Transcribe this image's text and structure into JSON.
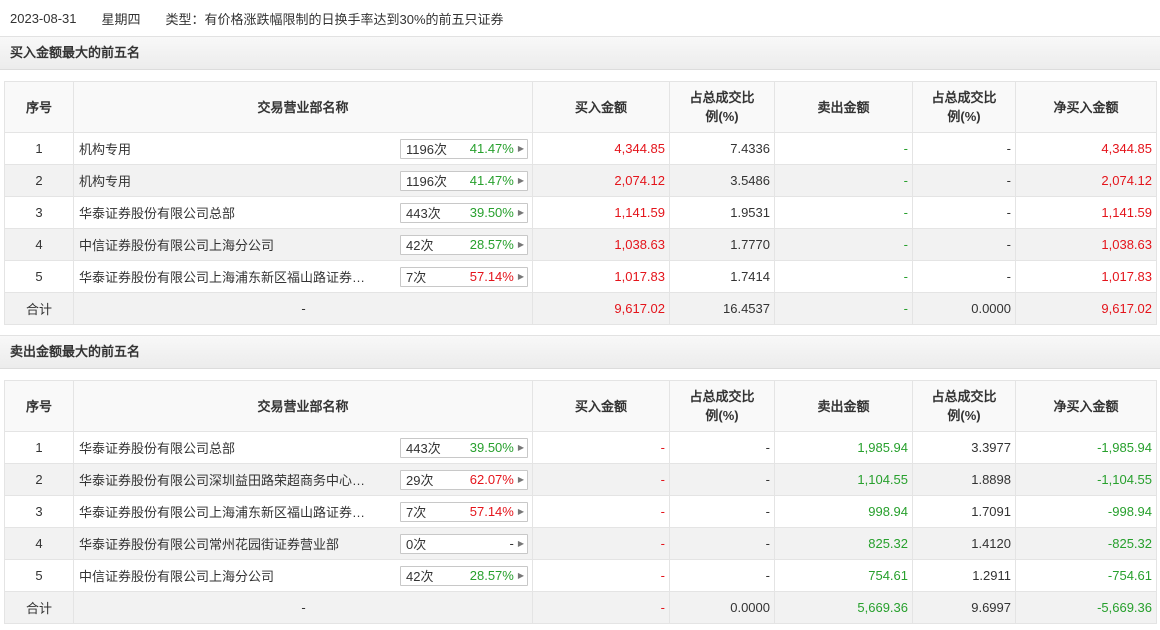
{
  "header": {
    "date": "2023-08-31",
    "weekday": "星期四",
    "type": "类型：有价格涨跌幅限制的日换手率达到30%的前五只证券"
  },
  "columns": {
    "idx": "序号",
    "name": "交易营业部名称",
    "buy": "买入金额",
    "buy_ratio_1": "占总成交比",
    "buy_ratio_2": "例(%)",
    "sell": "卖出金额",
    "sell_ratio_1": "占总成交比",
    "sell_ratio_2": "例(%)",
    "net": "净买入金额"
  },
  "buy_section": {
    "title": "买入金额最大的前五名",
    "rows": [
      {
        "idx": "1",
        "name": "机构专用",
        "count": "1196次",
        "pct": "41.47%",
        "pct_color": "green",
        "buy": "4,344.85",
        "buy_ratio": "7.4336",
        "sell": "-",
        "sell_ratio": "-",
        "net": "4,344.85"
      },
      {
        "idx": "2",
        "name": "机构专用",
        "count": "1196次",
        "pct": "41.47%",
        "pct_color": "green",
        "buy": "2,074.12",
        "buy_ratio": "3.5486",
        "sell": "-",
        "sell_ratio": "-",
        "net": "2,074.12"
      },
      {
        "idx": "3",
        "name": "华泰证券股份有限公司总部",
        "count": "443次",
        "pct": "39.50%",
        "pct_color": "green",
        "buy": "1,141.59",
        "buy_ratio": "1.9531",
        "sell": "-",
        "sell_ratio": "-",
        "net": "1,141.59"
      },
      {
        "idx": "4",
        "name": "中信证券股份有限公司上海分公司",
        "count": "42次",
        "pct": "28.57%",
        "pct_color": "green",
        "buy": "1,038.63",
        "buy_ratio": "1.7770",
        "sell": "-",
        "sell_ratio": "-",
        "net": "1,038.63"
      },
      {
        "idx": "5",
        "name": "华泰证券股份有限公司上海浦东新区福山路证券…",
        "count": "7次",
        "pct": "57.14%",
        "pct_color": "red",
        "buy": "1,017.83",
        "buy_ratio": "1.7414",
        "sell": "-",
        "sell_ratio": "-",
        "net": "1,017.83"
      }
    ],
    "total": {
      "idx": "合计",
      "name": "-",
      "buy": "9,617.02",
      "buy_ratio": "16.4537",
      "sell": "-",
      "sell_ratio": "0.0000",
      "net": "9,617.02"
    }
  },
  "sell_section": {
    "title": "卖出金额最大的前五名",
    "rows": [
      {
        "idx": "1",
        "name": "华泰证券股份有限公司总部",
        "count": "443次",
        "pct": "39.50%",
        "pct_color": "green",
        "buy": "-",
        "buy_ratio": "-",
        "sell": "1,985.94",
        "sell_ratio": "3.3977",
        "net": "-1,985.94"
      },
      {
        "idx": "2",
        "name": "华泰证券股份有限公司深圳益田路荣超商务中心…",
        "count": "29次",
        "pct": "62.07%",
        "pct_color": "red",
        "buy": "-",
        "buy_ratio": "-",
        "sell": "1,104.55",
        "sell_ratio": "1.8898",
        "net": "-1,104.55"
      },
      {
        "idx": "3",
        "name": "华泰证券股份有限公司上海浦东新区福山路证券…",
        "count": "7次",
        "pct": "57.14%",
        "pct_color": "red",
        "buy": "-",
        "buy_ratio": "-",
        "sell": "998.94",
        "sell_ratio": "1.7091",
        "net": "-998.94"
      },
      {
        "idx": "4",
        "name": "华泰证券股份有限公司常州花园街证券营业部",
        "count": "0次",
        "pct": "-",
        "pct_color": "dark",
        "buy": "-",
        "buy_ratio": "-",
        "sell": "825.32",
        "sell_ratio": "1.4120",
        "net": "-825.32"
      },
      {
        "idx": "5",
        "name": "中信证券股份有限公司上海分公司",
        "count": "42次",
        "pct": "28.57%",
        "pct_color": "green",
        "buy": "-",
        "buy_ratio": "-",
        "sell": "754.61",
        "sell_ratio": "1.2911",
        "net": "-754.61"
      }
    ],
    "total": {
      "idx": "合计",
      "name": "-",
      "buy": "-",
      "buy_ratio": "0.0000",
      "sell": "5,669.36",
      "sell_ratio": "9.6997",
      "net": "-5,669.36"
    }
  },
  "colors": {
    "red": "#e4141b",
    "green": "#27a02d",
    "dark": "#333333"
  },
  "icons": {
    "pill_arrow": "triangle-right-icon"
  }
}
